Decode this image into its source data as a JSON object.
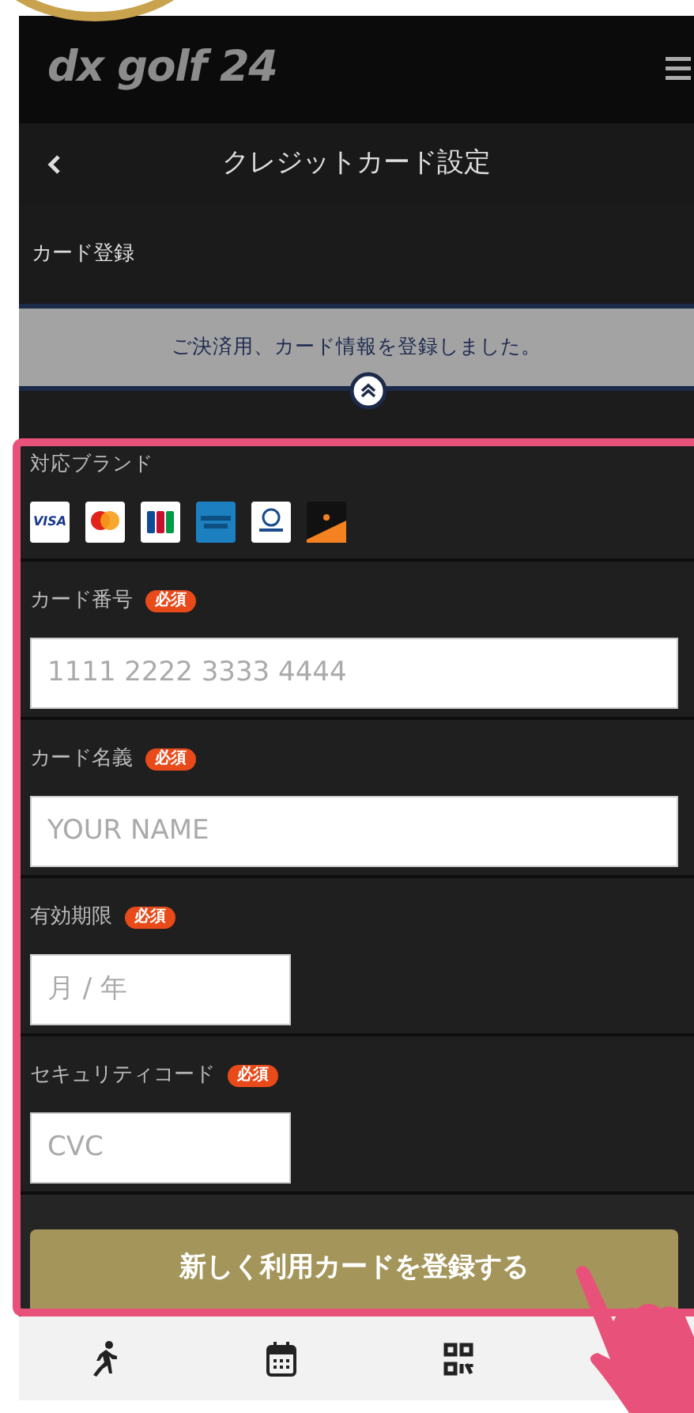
{
  "header": {
    "logo": "dx golf 24"
  },
  "title_bar": {
    "title": "クレジットカード設定"
  },
  "section": {
    "title": "カード登録"
  },
  "notice": {
    "message": "ご決済用、カード情報を登録しました。"
  },
  "brands": {
    "label": "対応ブランド",
    "items": [
      {
        "kind": "visa",
        "label": "VISA"
      },
      {
        "kind": "mastercard"
      },
      {
        "kind": "jcb"
      },
      {
        "kind": "amex"
      },
      {
        "kind": "diners"
      },
      {
        "kind": "discover"
      }
    ]
  },
  "fields": [
    {
      "label": "カード番号",
      "badge": "必須",
      "placeholder": "1111 2222 3333 4444",
      "kind": "wide"
    },
    {
      "label": "カード名義",
      "badge": "必須",
      "placeholder": "YOUR NAME",
      "kind": "wide"
    },
    {
      "label": "有効期限",
      "badge": "必須",
      "placeholder": "月 / 年",
      "kind": "narrow"
    },
    {
      "label": "セキュリティコード",
      "badge": "必須",
      "placeholder": "CVC",
      "kind": "narrow"
    }
  ],
  "submit_button": "新しく利用カードを登録する",
  "bottom_nav": [
    {
      "kind": "run"
    },
    {
      "kind": "calendar"
    },
    {
      "kind": "qr"
    }
  ]
}
